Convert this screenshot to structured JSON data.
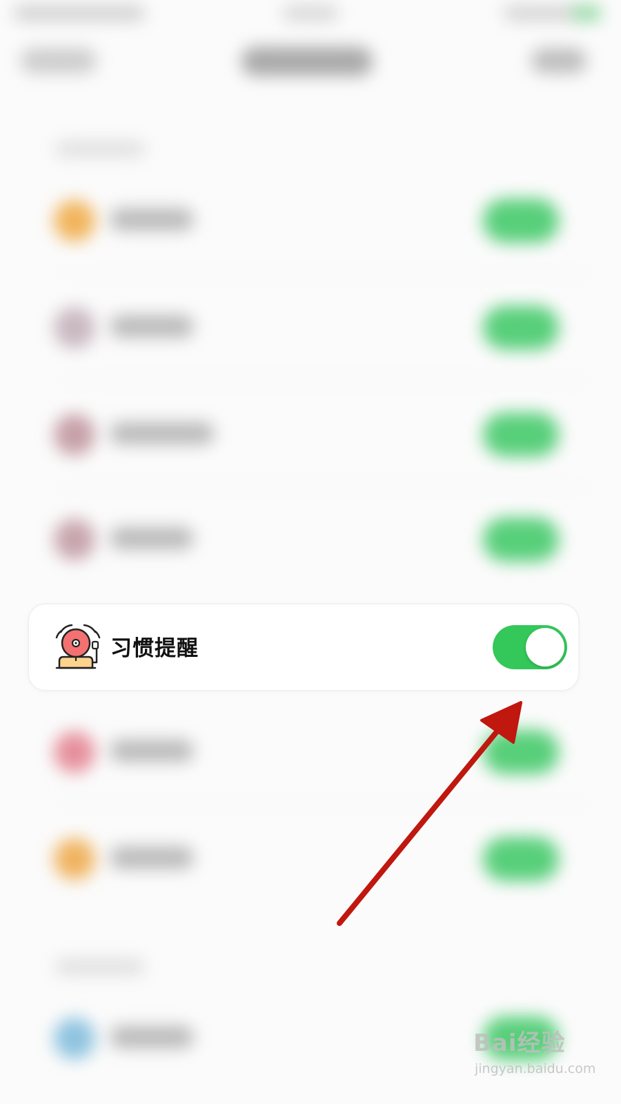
{
  "focused_setting": {
    "label": "习惯提醒",
    "icon": "alarm-bell-icon",
    "toggle_on": true
  },
  "colors": {
    "toggle_on": "#34c759",
    "arrow": "#c0170f",
    "alarm_red": "#f47171",
    "alarm_base": "#fbd38d"
  },
  "watermark": {
    "brand": "Bai经验",
    "url": "jingyan.baidu.com"
  }
}
